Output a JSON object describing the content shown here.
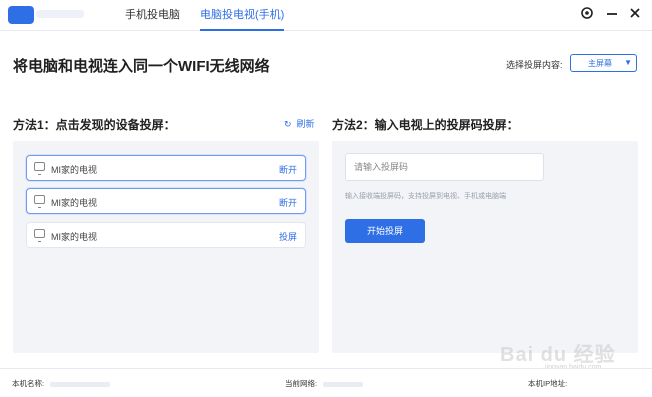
{
  "titlebar": {
    "tabs": [
      {
        "label": "手机投电脑",
        "active": false
      },
      {
        "label": "电脑投电视(手机)",
        "active": true
      }
    ],
    "buttons": {
      "settings_icon": "settings-gear",
      "minimize_icon": "minimize",
      "close_icon": "close"
    }
  },
  "header": {
    "title": "将电脑和电视连入同一个WIFI无线网络",
    "select_label": "选择投屏内容:",
    "select_value": "主屏幕"
  },
  "method1": {
    "title": "方法1：点击发现的设备投屏：",
    "refresh_label": "刷新",
    "devices": [
      {
        "name": "MI家的电视",
        "action": "断开",
        "active": true
      },
      {
        "name": "MI家的电视",
        "action": "断开",
        "active": true
      },
      {
        "name": "MI家的电视",
        "action": "投屏",
        "active": false
      }
    ]
  },
  "method2": {
    "title": "方法2：输入电视上的投屏码投屏：",
    "input_placeholder": "请输入投屏码",
    "hint": "输入接收端投屏码，支持投屏到电视、手机或电脑端",
    "start_button": "开始投屏"
  },
  "statusbar": {
    "machine_name_label": "本机名称:",
    "network_label": "当前网络:",
    "ip_label": "本机IP地址:"
  },
  "watermark": {
    "text": "Bai du 经验",
    "sub": "jingyan.baidu.com"
  },
  "colors": {
    "accent": "#2f6fe6",
    "panel_bg": "#f2f4f8"
  }
}
